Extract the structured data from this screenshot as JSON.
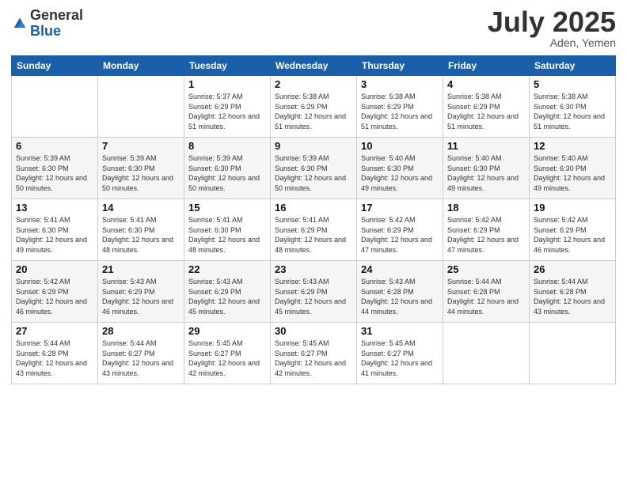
{
  "header": {
    "logo_general": "General",
    "logo_blue": "Blue",
    "month_title": "July 2025",
    "location": "Aden, Yemen"
  },
  "weekdays": [
    "Sunday",
    "Monday",
    "Tuesday",
    "Wednesday",
    "Thursday",
    "Friday",
    "Saturday"
  ],
  "weeks": [
    [
      {
        "day": "",
        "info": ""
      },
      {
        "day": "",
        "info": ""
      },
      {
        "day": "1",
        "info": "Sunrise: 5:37 AM\nSunset: 6:29 PM\nDaylight: 12 hours and 51 minutes."
      },
      {
        "day": "2",
        "info": "Sunrise: 5:38 AM\nSunset: 6:29 PM\nDaylight: 12 hours and 51 minutes."
      },
      {
        "day": "3",
        "info": "Sunrise: 5:38 AM\nSunset: 6:29 PM\nDaylight: 12 hours and 51 minutes."
      },
      {
        "day": "4",
        "info": "Sunrise: 5:38 AM\nSunset: 6:29 PM\nDaylight: 12 hours and 51 minutes."
      },
      {
        "day": "5",
        "info": "Sunrise: 5:38 AM\nSunset: 6:30 PM\nDaylight: 12 hours and 51 minutes."
      }
    ],
    [
      {
        "day": "6",
        "info": "Sunrise: 5:39 AM\nSunset: 6:30 PM\nDaylight: 12 hours and 50 minutes."
      },
      {
        "day": "7",
        "info": "Sunrise: 5:39 AM\nSunset: 6:30 PM\nDaylight: 12 hours and 50 minutes."
      },
      {
        "day": "8",
        "info": "Sunrise: 5:39 AM\nSunset: 6:30 PM\nDaylight: 12 hours and 50 minutes."
      },
      {
        "day": "9",
        "info": "Sunrise: 5:39 AM\nSunset: 6:30 PM\nDaylight: 12 hours and 50 minutes."
      },
      {
        "day": "10",
        "info": "Sunrise: 5:40 AM\nSunset: 6:30 PM\nDaylight: 12 hours and 49 minutes."
      },
      {
        "day": "11",
        "info": "Sunrise: 5:40 AM\nSunset: 6:30 PM\nDaylight: 12 hours and 49 minutes."
      },
      {
        "day": "12",
        "info": "Sunrise: 5:40 AM\nSunset: 6:30 PM\nDaylight: 12 hours and 49 minutes."
      }
    ],
    [
      {
        "day": "13",
        "info": "Sunrise: 5:41 AM\nSunset: 6:30 PM\nDaylight: 12 hours and 49 minutes."
      },
      {
        "day": "14",
        "info": "Sunrise: 5:41 AM\nSunset: 6:30 PM\nDaylight: 12 hours and 48 minutes."
      },
      {
        "day": "15",
        "info": "Sunrise: 5:41 AM\nSunset: 6:30 PM\nDaylight: 12 hours and 48 minutes."
      },
      {
        "day": "16",
        "info": "Sunrise: 5:41 AM\nSunset: 6:29 PM\nDaylight: 12 hours and 48 minutes."
      },
      {
        "day": "17",
        "info": "Sunrise: 5:42 AM\nSunset: 6:29 PM\nDaylight: 12 hours and 47 minutes."
      },
      {
        "day": "18",
        "info": "Sunrise: 5:42 AM\nSunset: 6:29 PM\nDaylight: 12 hours and 47 minutes."
      },
      {
        "day": "19",
        "info": "Sunrise: 5:42 AM\nSunset: 6:29 PM\nDaylight: 12 hours and 46 minutes."
      }
    ],
    [
      {
        "day": "20",
        "info": "Sunrise: 5:42 AM\nSunset: 6:29 PM\nDaylight: 12 hours and 46 minutes."
      },
      {
        "day": "21",
        "info": "Sunrise: 5:43 AM\nSunset: 6:29 PM\nDaylight: 12 hours and 46 minutes."
      },
      {
        "day": "22",
        "info": "Sunrise: 5:43 AM\nSunset: 6:29 PM\nDaylight: 12 hours and 45 minutes."
      },
      {
        "day": "23",
        "info": "Sunrise: 5:43 AM\nSunset: 6:29 PM\nDaylight: 12 hours and 45 minutes."
      },
      {
        "day": "24",
        "info": "Sunrise: 5:43 AM\nSunset: 6:28 PM\nDaylight: 12 hours and 44 minutes."
      },
      {
        "day": "25",
        "info": "Sunrise: 5:44 AM\nSunset: 6:28 PM\nDaylight: 12 hours and 44 minutes."
      },
      {
        "day": "26",
        "info": "Sunrise: 5:44 AM\nSunset: 6:28 PM\nDaylight: 12 hours and 43 minutes."
      }
    ],
    [
      {
        "day": "27",
        "info": "Sunrise: 5:44 AM\nSunset: 6:28 PM\nDaylight: 12 hours and 43 minutes."
      },
      {
        "day": "28",
        "info": "Sunrise: 5:44 AM\nSunset: 6:27 PM\nDaylight: 12 hours and 43 minutes."
      },
      {
        "day": "29",
        "info": "Sunrise: 5:45 AM\nSunset: 6:27 PM\nDaylight: 12 hours and 42 minutes."
      },
      {
        "day": "30",
        "info": "Sunrise: 5:45 AM\nSunset: 6:27 PM\nDaylight: 12 hours and 42 minutes."
      },
      {
        "day": "31",
        "info": "Sunrise: 5:45 AM\nSunset: 6:27 PM\nDaylight: 12 hours and 41 minutes."
      },
      {
        "day": "",
        "info": ""
      },
      {
        "day": "",
        "info": ""
      }
    ]
  ]
}
